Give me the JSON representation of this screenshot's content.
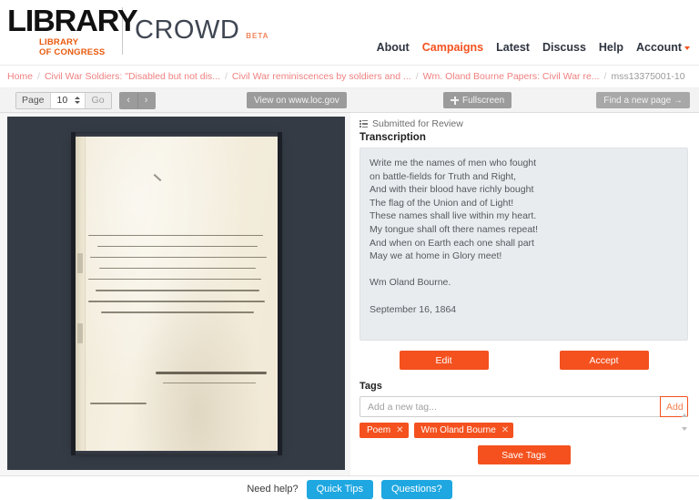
{
  "header": {
    "logo_word": "LIBRARY",
    "logo_sub_line1": "LIBRARY",
    "logo_sub_line2": "OF CONGRESS",
    "app_name": "CROWD",
    "beta_tag": "BETA",
    "nav": [
      {
        "label": "About",
        "active": false
      },
      {
        "label": "Campaigns",
        "active": true
      },
      {
        "label": "Latest",
        "active": false
      },
      {
        "label": "Discuss",
        "active": false
      },
      {
        "label": "Help",
        "active": false
      },
      {
        "label": "Account",
        "active": false
      }
    ]
  },
  "breadcrumb": {
    "items": [
      "Home",
      "Civil War Soldiers: \"Disabled but not dis...",
      "Civil War reminiscences by soldiers and ...",
      "Wm. Oland Bourne Papers: Civil War re..."
    ],
    "current": "mss13375001-10",
    "separator": "/"
  },
  "toolbar": {
    "page_label": "Page",
    "page_value": "10",
    "go_label": "Go",
    "prev_arrow": "‹",
    "next_arrow": "›",
    "view_loc_label": "View on www.loc.gov",
    "fullscreen_label": "Fullscreen",
    "find_new_page_label": "Find a new page →"
  },
  "panel": {
    "status": "Submitted for Review",
    "title": "Transcription",
    "transcription_lines": [
      "Write me the names of men who fought",
      "on battle-fields for Truth and Right,",
      "And with their blood have richly bought",
      "The flag of the Union and of Light!",
      "These names shall live within my heart.",
      "My tongue shall oft there names repeat!",
      "And when on Earth each one shall part",
      "May we at home in Glory meet!"
    ],
    "signature": "Wm Oland Bourne.",
    "date": "September 16, 1864",
    "edit_label": "Edit",
    "accept_label": "Accept"
  },
  "tags": {
    "title": "Tags",
    "input_placeholder": "Add a new tag...",
    "input_value": "",
    "add_label": "Add",
    "chips": [
      {
        "label": "Poem",
        "remove": "✕"
      },
      {
        "label": "Wm Oland Bourne",
        "remove": "✕"
      }
    ],
    "save_label": "Save Tags"
  },
  "footer": {
    "need_help": "Need help?",
    "quick_tips": "Quick Tips",
    "questions": "Questions?"
  },
  "colors": {
    "accent_orange": "#f4511e",
    "brand_orange": "#e8590c",
    "link_pink": "#f08080",
    "blue": "#1ea7e1",
    "viewer_bg": "#343b45"
  }
}
